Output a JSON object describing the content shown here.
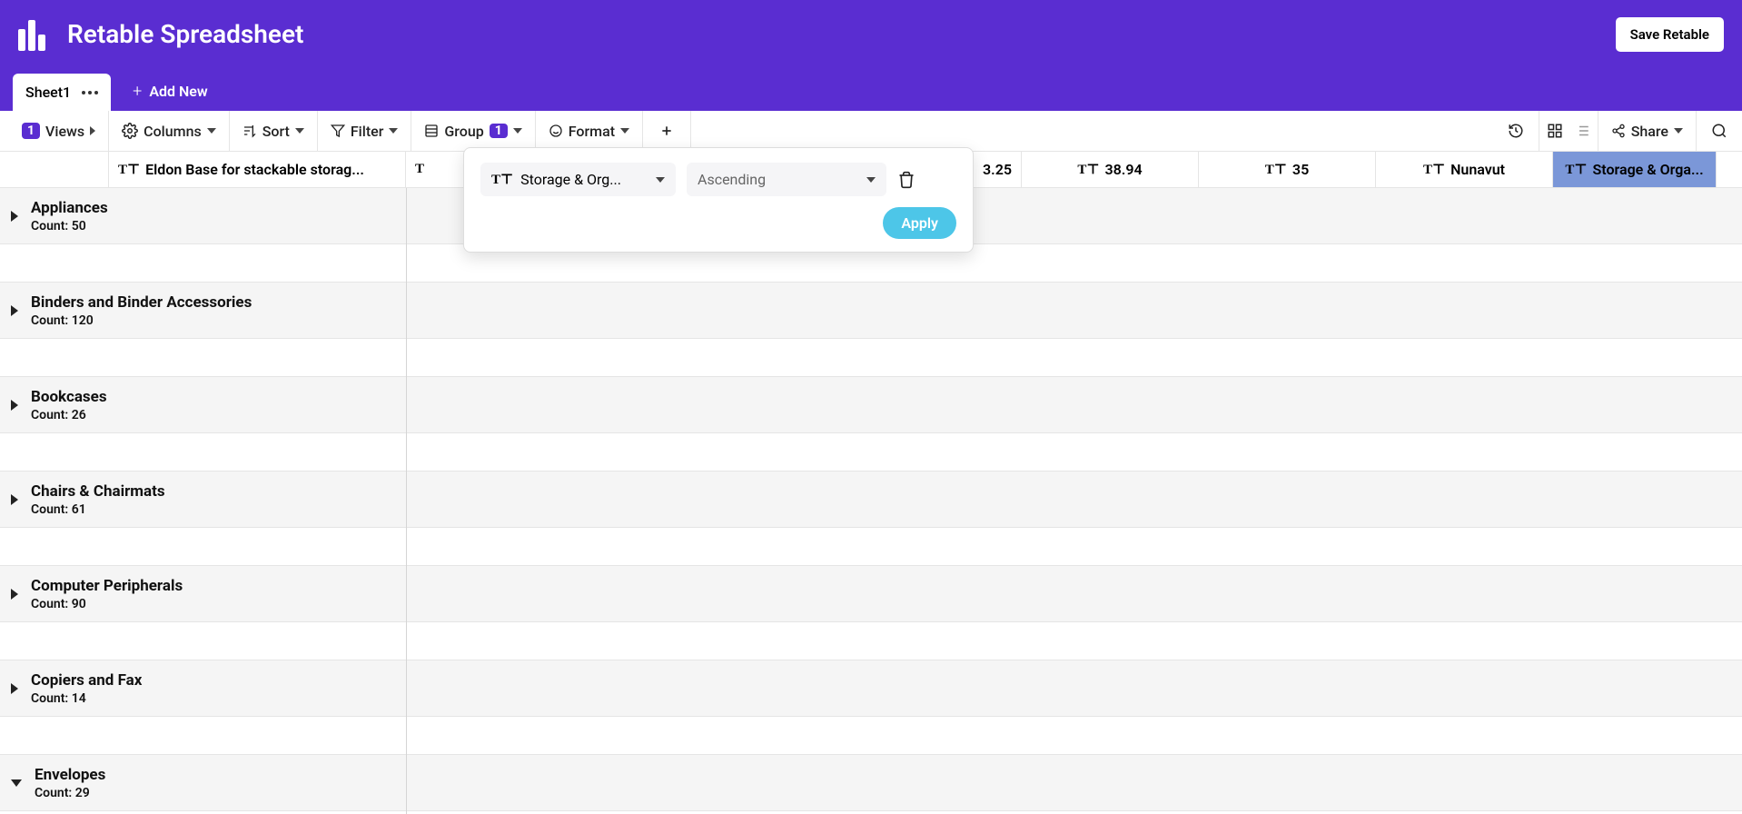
{
  "app_title": "Retable Spreadsheet",
  "save_button": "Save Retable",
  "tabs": {
    "active": "Sheet1",
    "add_new": "Add New"
  },
  "toolbar": {
    "views": {
      "label": "Views",
      "badge": "1"
    },
    "columns": "Columns",
    "sort": "Sort",
    "filter": "Filter",
    "group": {
      "label": "Group",
      "badge": "1"
    },
    "format": "Format",
    "share": "Share"
  },
  "group_popup": {
    "column_select": "Storage & Org...",
    "direction_select": "Ascending",
    "apply": "Apply"
  },
  "columns": [
    {
      "label": "Eldon Base for stackable storag...",
      "type": "text",
      "width": "wide"
    },
    {
      "label": "",
      "type": "text",
      "width": "std"
    },
    {
      "label": "",
      "type": "text",
      "width": "std"
    },
    {
      "label": "",
      "type": "text",
      "width": "std"
    },
    {
      "label": "3.25",
      "type": "text",
      "width": "std-right"
    },
    {
      "label": "38.94",
      "type": "text",
      "width": "std"
    },
    {
      "label": "35",
      "type": "text",
      "width": "std"
    },
    {
      "label": "Nunavut",
      "type": "text",
      "width": "std"
    },
    {
      "label": "Storage & Orga...",
      "type": "text",
      "width": "std",
      "highlight": true
    }
  ],
  "groups": [
    {
      "name": "Appliances",
      "count_label": "Count: 50",
      "expanded": false
    },
    {
      "name": "Binders and Binder Accessories",
      "count_label": "Count: 120",
      "expanded": false
    },
    {
      "name": "Bookcases",
      "count_label": "Count: 26",
      "expanded": false
    },
    {
      "name": "Chairs & Chairmats",
      "count_label": "Count: 61",
      "expanded": false
    },
    {
      "name": "Computer Peripherals",
      "count_label": "Count: 90",
      "expanded": false
    },
    {
      "name": "Copiers and Fax",
      "count_label": "Count: 14",
      "expanded": false
    },
    {
      "name": "Envelopes",
      "count_label": "Count: 29",
      "expanded": true
    }
  ]
}
